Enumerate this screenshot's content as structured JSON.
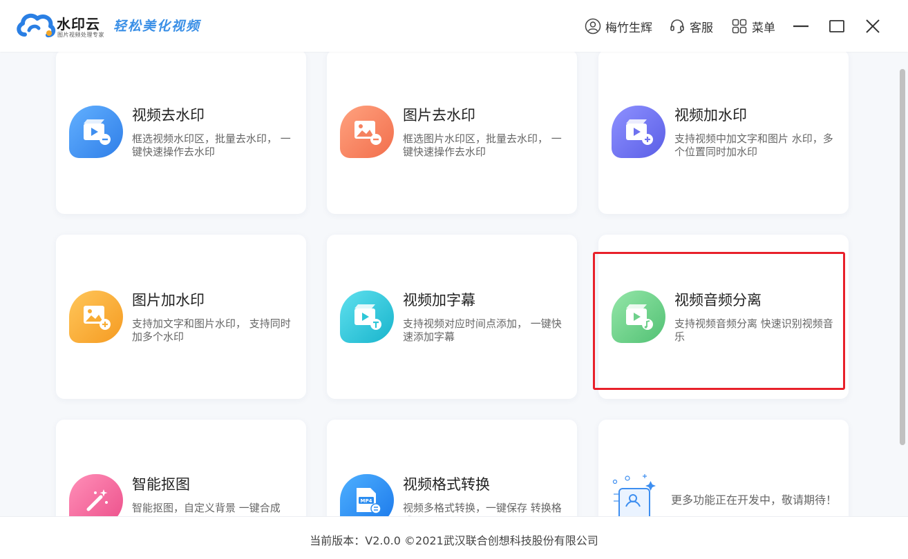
{
  "header": {
    "logo_name": "水印云",
    "logo_sub": "图片视频处理专家",
    "slogan": "轻松美化视频",
    "user_label": "梅竹生辉",
    "service_label": "客服",
    "menu_label": "菜单"
  },
  "cards": [
    {
      "title": "视频去水印",
      "desc": "框选视频水印区，批量去水印，  一键快速操作去水印",
      "icon": "video-remove-icon",
      "color": "#3d8ef0"
    },
    {
      "title": "图片去水印",
      "desc": "框选图片水印区，批量去水印，  一键快速操作去水印",
      "icon": "image-remove-icon",
      "color": "#f5825f"
    },
    {
      "title": "视频加水印",
      "desc": "支持视频中加文字和图片 水印，多个位置同时加水印",
      "icon": "video-add-icon",
      "color": "#6e72ef"
    },
    {
      "title": "图片加水印",
      "desc": "支持加文字和图片水印，  支持同时加多个水印",
      "icon": "image-add-icon",
      "color": "#f8ac34"
    },
    {
      "title": "视频加字幕",
      "desc": "支持视频对应时间点添加，  一键快速添加字幕",
      "icon": "video-subtitle-icon",
      "color": "#2ec7d8"
    },
    {
      "title": "视频音频分离",
      "desc": "支持视频音频分离 快速识别视频音乐",
      "icon": "video-audio-icon",
      "color": "#6fd08b"
    },
    {
      "title": "智能抠图",
      "desc": "智能抠图，自定义背景 一键合成",
      "icon": "magic-wand-icon",
      "color": "#f26a9d"
    },
    {
      "title": "视频格式转换",
      "desc": "视频多格式转换，一键保存 转换格式",
      "icon": "mp4-icon",
      "color": "#2a8cf0"
    },
    {
      "title": "",
      "desc": "更多功能正在开发中，敬请期待！",
      "icon": "coming-soon-illustration-icon",
      "color": "#3d8ef0"
    }
  ],
  "footer": {
    "text": "当前版本：V2.0.0 ©2021武汉联合创想科技股份有限公司"
  }
}
